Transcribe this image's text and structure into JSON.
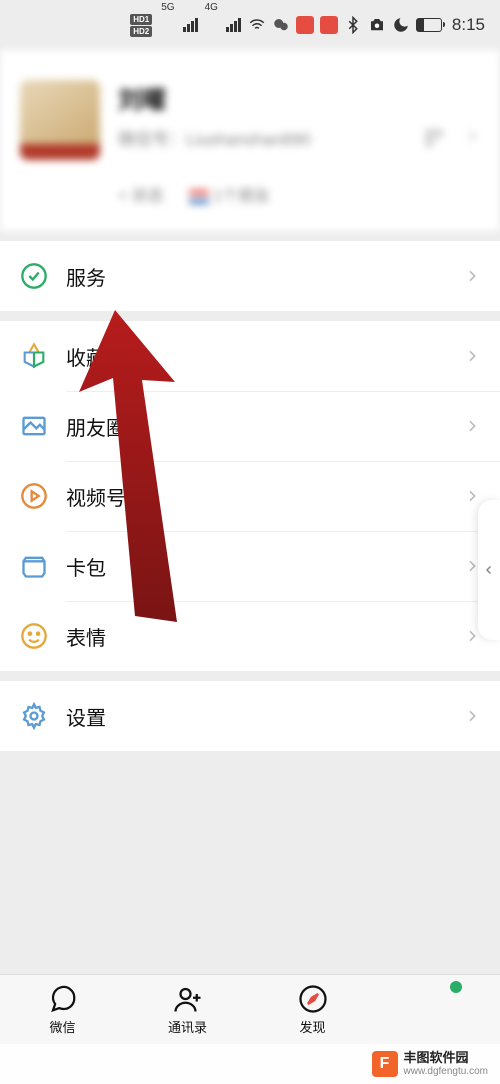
{
  "status": {
    "hd1": "HD1",
    "hd2": "HD2",
    "net5g": "5G",
    "net4g": "4G",
    "time": "8:15"
  },
  "profile": {
    "name": "刘曜",
    "id_label": "微信号：",
    "id_value": "Liushanshan890",
    "status_text": "+ 状态",
    "region_text": "1个朋友"
  },
  "menu_services": {
    "label": "服务"
  },
  "menu_favorites": {
    "label": "收藏"
  },
  "menu_moments": {
    "label": "朋友圈"
  },
  "menu_channels": {
    "label": "视频号"
  },
  "menu_cards": {
    "label": "卡包"
  },
  "menu_stickers": {
    "label": "表情"
  },
  "menu_settings": {
    "label": "设置"
  },
  "nav": {
    "chats": "微信",
    "contacts": "通讯录",
    "discover": "发现",
    "me": ""
  },
  "watermark": {
    "title": "丰图软件园",
    "url": "www.dgfengtu.com",
    "logo": "F"
  }
}
